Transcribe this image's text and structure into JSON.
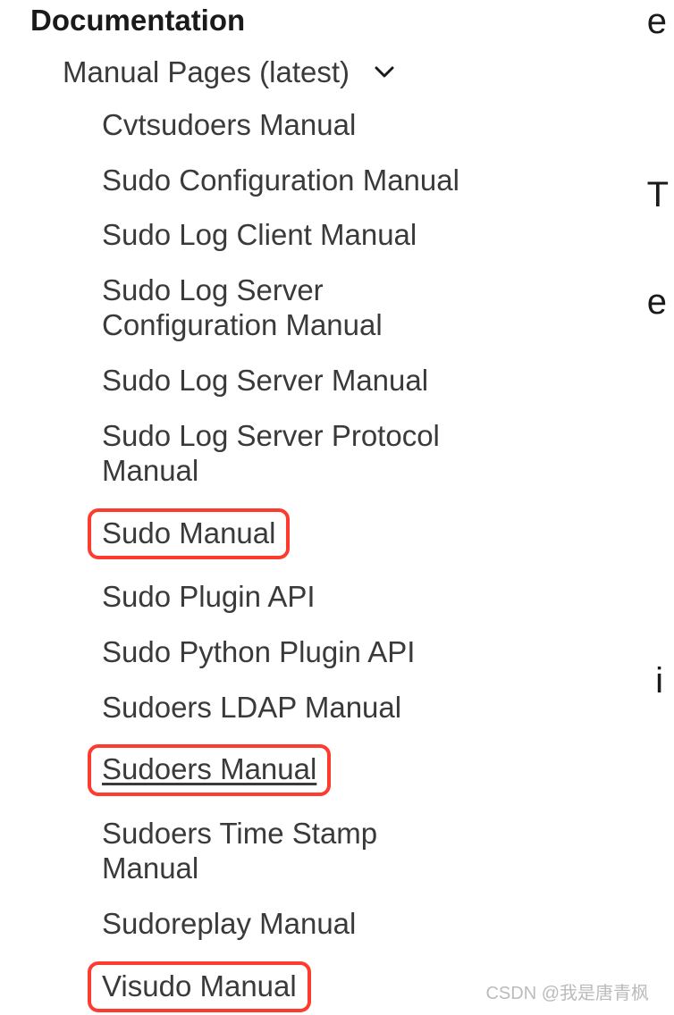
{
  "header": "Documentation",
  "section": {
    "label": "Manual Pages (latest)"
  },
  "nav": {
    "items": [
      {
        "label": "Cvtsudoers Manual",
        "highlighted": false,
        "underlined": false
      },
      {
        "label": "Sudo Configuration Manual",
        "highlighted": false,
        "underlined": false
      },
      {
        "label": "Sudo Log Client Manual",
        "highlighted": false,
        "underlined": false
      },
      {
        "label": "Sudo Log Server Configuration Manual",
        "highlighted": false,
        "underlined": false
      },
      {
        "label": "Sudo Log Server Manual",
        "highlighted": false,
        "underlined": false
      },
      {
        "label": "Sudo Log Server Protocol Manual",
        "highlighted": false,
        "underlined": false
      },
      {
        "label": "Sudo Manual",
        "highlighted": true,
        "underlined": false
      },
      {
        "label": "Sudo Plugin API",
        "highlighted": false,
        "underlined": false
      },
      {
        "label": "Sudo Python Plugin API",
        "highlighted": false,
        "underlined": false
      },
      {
        "label": "Sudoers LDAP Manual",
        "highlighted": false,
        "underlined": false
      },
      {
        "label": "Sudoers Manual",
        "highlighted": true,
        "underlined": true
      },
      {
        "label": "Sudoers Time Stamp Manual",
        "highlighted": false,
        "underlined": false
      },
      {
        "label": "Sudoreplay Manual",
        "highlighted": false,
        "underlined": false
      },
      {
        "label": "Visudo Manual",
        "highlighted": true,
        "underlined": false
      }
    ]
  },
  "side_chars": [
    "e",
    "T",
    "e",
    "i"
  ],
  "watermark": "CSDN @我是唐青枫"
}
